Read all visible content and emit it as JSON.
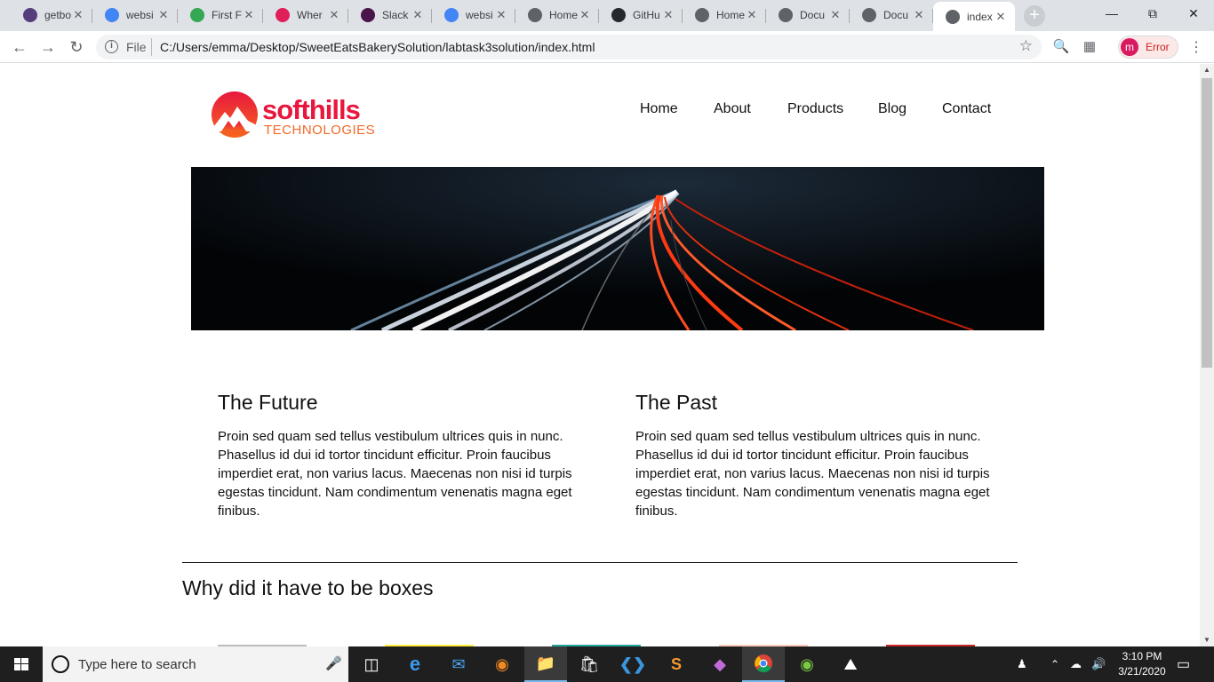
{
  "browser": {
    "tabs": [
      {
        "title": "getbo",
        "icon": "bootstrap-icon",
        "color": "#563d7c"
      },
      {
        "title": "websi",
        "icon": "google-icon",
        "color": "#4285f4"
      },
      {
        "title": "First F",
        "icon": "maps-icon",
        "color": "#34a853"
      },
      {
        "title": "Wher",
        "icon": "slack-icon",
        "color": "#e01e5a"
      },
      {
        "title": "Slack",
        "icon": "slack-icon",
        "color": "#4a154b"
      },
      {
        "title": "websi",
        "icon": "google-icon",
        "color": "#4285f4"
      },
      {
        "title": "Home",
        "icon": "globe-icon",
        "color": "#5f6368"
      },
      {
        "title": "GitHu",
        "icon": "github-icon",
        "color": "#24292e"
      },
      {
        "title": "Home",
        "icon": "globe-icon",
        "color": "#5f6368"
      },
      {
        "title": "Docu",
        "icon": "globe-icon",
        "color": "#5f6368"
      },
      {
        "title": "Docu",
        "icon": "globe-icon",
        "color": "#5f6368"
      },
      {
        "title": "index",
        "icon": "globe-icon",
        "color": "#5f6368",
        "active": true
      }
    ],
    "address": {
      "scheme_label": "File",
      "url": "C:/Users/emma/Desktop/SweetEatsBakerySolution/labtask3solution/index.html"
    },
    "profile": {
      "initial": "m",
      "status": "Error"
    }
  },
  "page": {
    "logo": {
      "brand": "softhills",
      "sub": "TECHNOLOGIES"
    },
    "nav": [
      "Home",
      "About",
      "Products",
      "Blog",
      "Contact"
    ],
    "columns": [
      {
        "title": "The Future",
        "text": "Proin sed quam sed tellus vestibulum ultrices quis in nunc. Phasellus id dui id tortor tincidunt efficitur. Proin faucibus imperdiet erat, non varius lacus. Maecenas non nisi id turpis egestas tincidunt. Nam condimentum venenatis magna eget finibus."
      },
      {
        "title": "The Past",
        "text": "Proin sed quam sed tellus vestibulum ultrices quis in nunc. Phasellus id dui id tortor tincidunt efficitur. Proin faucibus imperdiet erat, non varius lacus. Maecenas non nisi id turpis egestas tincidunt. Nam condimentum venenatis magna eget finibus."
      }
    ],
    "section_title": "Why did it have to be boxes",
    "box_colors": [
      "#bdbdbd",
      "#ffeb3b",
      "#26a69a",
      "#ffccbc",
      "#c62828"
    ]
  },
  "taskbar": {
    "search_placeholder": "Type here to search",
    "time": "3:10 PM",
    "date": "3/21/2020"
  }
}
